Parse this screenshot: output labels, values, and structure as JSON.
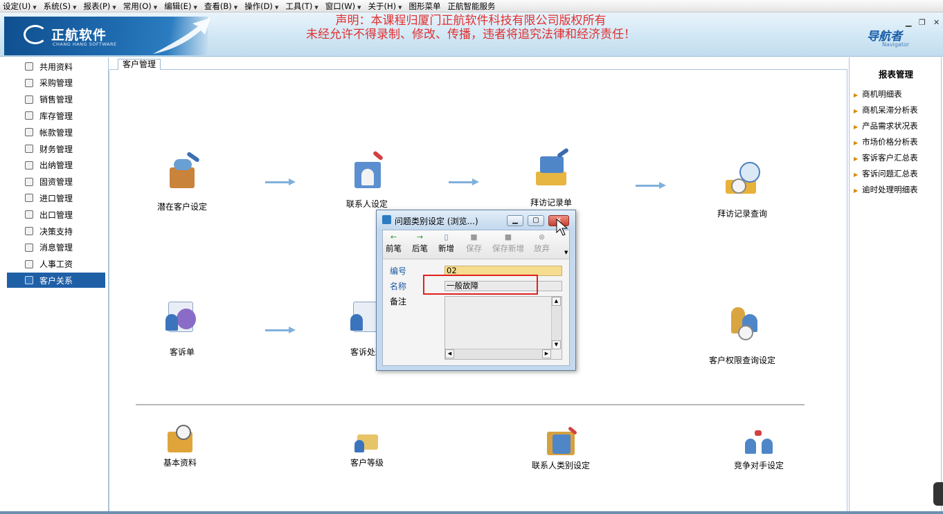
{
  "menu": [
    {
      "label": "设定",
      "key": "(U)"
    },
    {
      "label": "系统",
      "key": "(S)"
    },
    {
      "label": "报表",
      "key": "(P)"
    },
    {
      "label": "常用",
      "key": "(O)"
    },
    {
      "label": "编辑",
      "key": "(E)"
    },
    {
      "label": "查看",
      "key": "(B)"
    },
    {
      "label": "操作",
      "key": "(D)"
    },
    {
      "label": "工具",
      "key": "(T)"
    },
    {
      "label": "窗口",
      "key": "(W)"
    },
    {
      "label": "关于",
      "key": "(H)"
    },
    {
      "label": "图形菜单",
      "key": ""
    },
    {
      "label": "正航智能服务",
      "key": ""
    }
  ],
  "banner": {
    "logo_text": "正航软件",
    "logo_sub": "CHANG HANG SOFTWARE",
    "notice_line1": "声明：本课程归厦门正航软件科技有限公司版权所有",
    "notice_line2": "未经允许不得录制、修改、传播，违者将追究法律和经济责任！",
    "navigator": "导航者",
    "navigator_sub": "Navigator"
  },
  "sidebar": [
    {
      "label": "共用资料",
      "active": false
    },
    {
      "label": "采购管理",
      "active": false
    },
    {
      "label": "销售管理",
      "active": false
    },
    {
      "label": "库存管理",
      "active": false
    },
    {
      "label": "帐款管理",
      "active": false
    },
    {
      "label": "财务管理",
      "active": false
    },
    {
      "label": "出纳管理",
      "active": false
    },
    {
      "label": "固资管理",
      "active": false
    },
    {
      "label": "进口管理",
      "active": false
    },
    {
      "label": "出口管理",
      "active": false
    },
    {
      "label": "决策支持",
      "active": false
    },
    {
      "label": "消息管理",
      "active": false
    },
    {
      "label": "人事工资",
      "active": false
    },
    {
      "label": "客户关系",
      "active": true
    }
  ],
  "tab": {
    "label": "客户管理"
  },
  "tiles": {
    "potential_customer": "潜在客户设定",
    "contact_setup": "联系人设定",
    "visit_record": "拜访记录单",
    "visit_query": "拜访记录查询",
    "complaint": "客诉单",
    "complaint_handle": "客诉处理",
    "customer_permission": "客户权限查询设定",
    "basic_data": "基本资料",
    "customer_level": "客户等级",
    "contact_category": "联系人类别设定",
    "competitor": "竞争对手设定"
  },
  "report_panel": {
    "title": "报表管理",
    "items": [
      "商机明细表",
      "商机呆滞分析表",
      "产品需求状况表",
      "市场价格分析表",
      "客诉客户汇总表",
      "客诉问题汇总表",
      "逾时处理明细表"
    ]
  },
  "dialog": {
    "title": "问题类别设定 (浏览...)",
    "toolbar": [
      {
        "label": "前笔",
        "icon": "←",
        "disabled": false
      },
      {
        "label": "后笔",
        "icon": "→",
        "disabled": false
      },
      {
        "label": "新增",
        "icon": "▯",
        "disabled": false
      },
      {
        "label": "保存",
        "icon": "■",
        "disabled": true
      },
      {
        "label": "保存新增",
        "icon": "■",
        "disabled": true
      },
      {
        "label": "放弃",
        "icon": "⊗",
        "disabled": true
      }
    ],
    "fields": {
      "code_label": "编号",
      "code_value": "02",
      "name_label": "名称",
      "name_value": "一般故障",
      "note_label": "备注"
    },
    "close_label": "✕",
    "min_label": "▁",
    "max_label": "▢"
  },
  "colors": {
    "accent": "#1f5fa6",
    "notice": "#e03030",
    "highlight": "#e02020",
    "field_yellow": "#f6dc8e"
  }
}
